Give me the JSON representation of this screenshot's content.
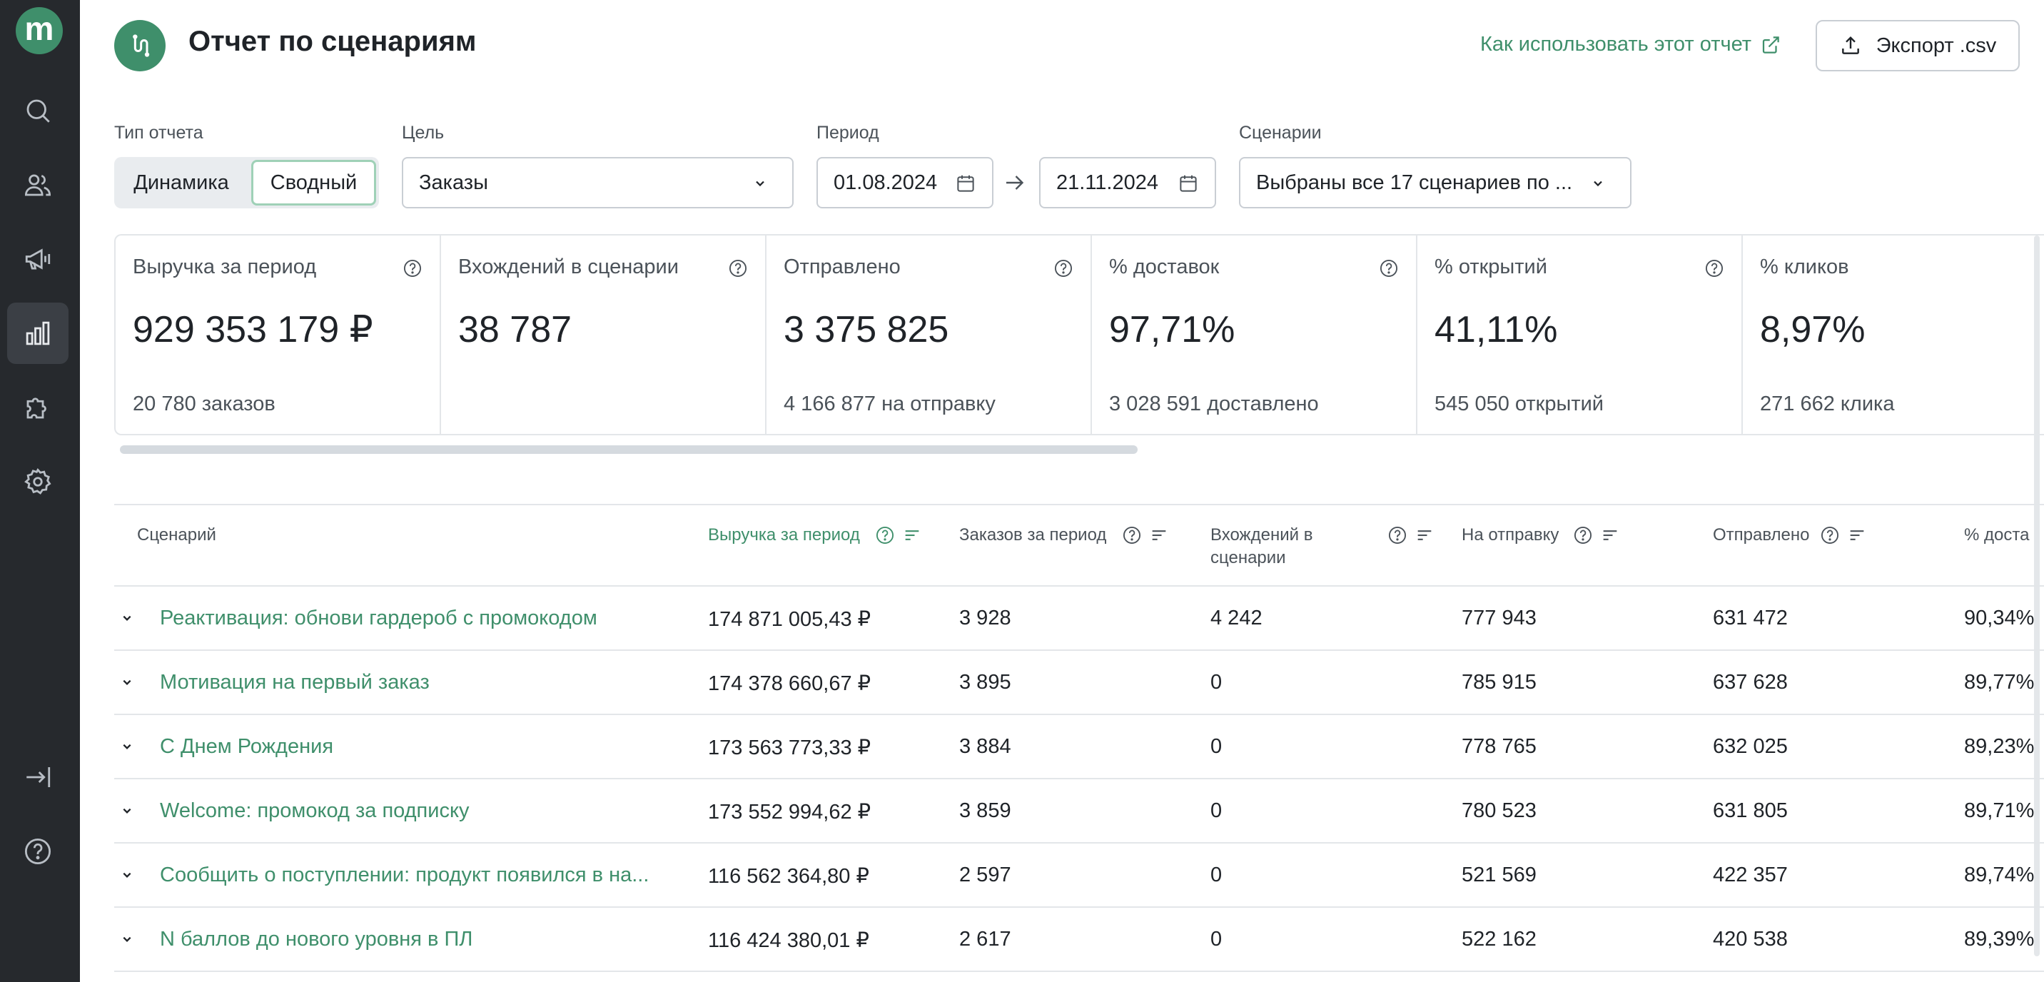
{
  "app": {
    "logo_letter": "m",
    "page_title": "Отчет по сценариям",
    "help_link": "Как использовать этот отчет",
    "export_label": "Экспорт .csv"
  },
  "sidebar": {
    "items": [
      {
        "icon": "search-icon",
        "active": false
      },
      {
        "icon": "users-icon",
        "active": false
      },
      {
        "icon": "megaphone-icon",
        "active": false
      },
      {
        "icon": "bar-chart-icon",
        "active": true
      },
      {
        "icon": "puzzle-icon",
        "active": false
      },
      {
        "icon": "gear-icon",
        "active": false
      }
    ],
    "bottom": [
      {
        "icon": "logout-icon"
      },
      {
        "icon": "help-icon"
      }
    ]
  },
  "filters": {
    "report_type_label": "Тип отчета",
    "report_type_options": [
      "Динамика",
      "Сводный"
    ],
    "report_type_selected": "Сводный",
    "goal_label": "Цель",
    "goal_value": "Заказы",
    "period_label": "Период",
    "date_from": "01.08.2024",
    "date_to": "21.11.2024",
    "scenarios_label": "Сценарии",
    "scenarios_value": "Выбраны все 17 сценариев по ..."
  },
  "metrics": [
    {
      "title": "Выручка за период",
      "value": "929 353 179 ₽",
      "sub": "20 780 заказов"
    },
    {
      "title": "Вхождений в сценарии",
      "value": "38 787",
      "sub": ""
    },
    {
      "title": "Отправлено",
      "value": "3 375 825",
      "sub": "4 166 877 на отправку"
    },
    {
      "title": "% доставок",
      "value": "97,71%",
      "sub": "3 028 591 доставлено"
    },
    {
      "title": "% открытий",
      "value": "41,11%",
      "sub": "545 050 открытий"
    },
    {
      "title": "% кликов",
      "value": "8,97%",
      "sub": "271 662 клика"
    }
  ],
  "table": {
    "columns": [
      {
        "label": "Сценарий"
      },
      {
        "label": "Выручка за период",
        "sorted": true
      },
      {
        "label": "Заказов за период"
      },
      {
        "label": "Вхождений в\nсценарии"
      },
      {
        "label": "На отправку"
      },
      {
        "label": "Отправлено"
      },
      {
        "label": "% доста"
      }
    ],
    "rows": [
      {
        "name": "Реактивация: обнови гардероб с промокодом",
        "revenue": "174 871 005,43 ₽",
        "orders": "3 928",
        "entries": "4 242",
        "to_send": "777 943",
        "sent": "631 472",
        "delivery": "90,34%"
      },
      {
        "name": "Мотивация на первый заказ",
        "revenue": "174 378 660,67 ₽",
        "orders": "3 895",
        "entries": "0",
        "to_send": "785 915",
        "sent": "637 628",
        "delivery": "89,77%"
      },
      {
        "name": "С Днем Рождения",
        "revenue": "173 563 773,33 ₽",
        "orders": "3 884",
        "entries": "0",
        "to_send": "778 765",
        "sent": "632 025",
        "delivery": "89,23%"
      },
      {
        "name": "Welcome: промокод за подписку",
        "revenue": "173 552 994,62 ₽",
        "orders": "3 859",
        "entries": "0",
        "to_send": "780 523",
        "sent": "631 805",
        "delivery": "89,71%"
      },
      {
        "name": "Сообщить о поступлении: продукт появился в на...",
        "revenue": "116 562 364,80 ₽",
        "orders": "2 597",
        "entries": "0",
        "to_send": "521 569",
        "sent": "422 357",
        "delivery": "89,74%"
      },
      {
        "name": "N баллов до нового уровня в ПЛ",
        "revenue": "116 424 380,01 ₽",
        "orders": "2 617",
        "entries": "0",
        "to_send": "522 162",
        "sent": "420 538",
        "delivery": "89,39%"
      }
    ]
  },
  "colors": {
    "accent": "#3f8f6b",
    "sidebar": "#26292d",
    "border": "#e3e6e9"
  }
}
